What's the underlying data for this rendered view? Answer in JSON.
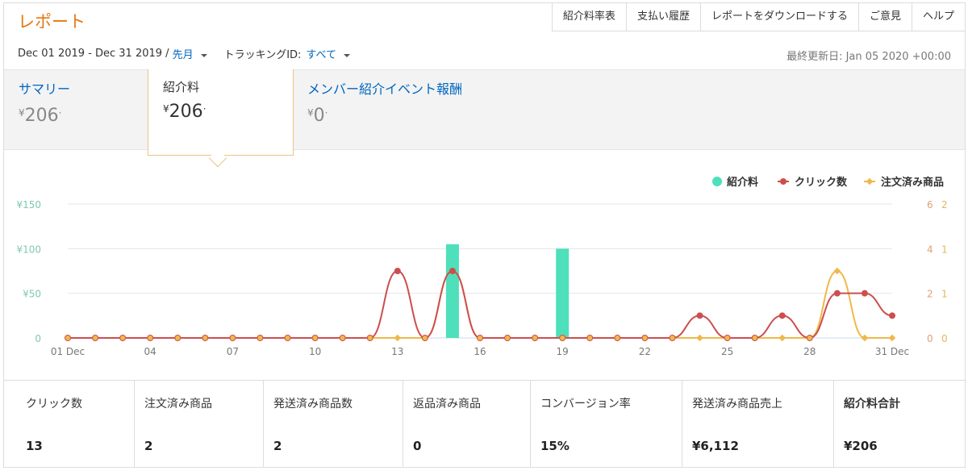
{
  "header": {
    "title": "レポート",
    "nav": [
      "紹介料率表",
      "支払い履歴",
      "レポートをダウンロードする",
      "ご意見",
      "ヘルプ"
    ]
  },
  "filters": {
    "date_range": "Dec 01 2019 - Dec 31 2019 /",
    "period": "先月",
    "tracking_label": "トラッキングID:",
    "tracking_value": "すべて"
  },
  "updated": "最終更新日: Jan 05 2020 +00:00",
  "summary": {
    "summary_label": "サマリー",
    "summary_value": "206",
    "referral_label": "紹介料",
    "referral_value": "206",
    "member_label": "メンバー紹介イベント報酬",
    "member_value": "0",
    "currency": "¥",
    "dot": "·"
  },
  "legend": [
    "紹介料",
    "クリック数",
    "注文済み商品"
  ],
  "colors": {
    "fee": "#4de0bb",
    "clicks": "#cc4e4e",
    "orders": "#f0b84a",
    "accent": "#e47911",
    "link": "#0066c0"
  },
  "chart_data": {
    "type": "line",
    "x": [
      1,
      2,
      3,
      4,
      5,
      6,
      7,
      8,
      9,
      10,
      11,
      12,
      13,
      14,
      15,
      16,
      17,
      18,
      19,
      20,
      21,
      22,
      23,
      24,
      25,
      26,
      27,
      28,
      29,
      30,
      31
    ],
    "xticks": [
      {
        "day": 1,
        "label": "01 Dec"
      },
      {
        "day": 4,
        "label": "04"
      },
      {
        "day": 7,
        "label": "07"
      },
      {
        "day": 10,
        "label": "10"
      },
      {
        "day": 13,
        "label": "13"
      },
      {
        "day": 16,
        "label": "16"
      },
      {
        "day": 19,
        "label": "19"
      },
      {
        "day": 22,
        "label": "22"
      },
      {
        "day": 25,
        "label": "25"
      },
      {
        "day": 28,
        "label": "28"
      },
      {
        "day": 31,
        "label": "31 Dec"
      }
    ],
    "y_fee_ticks": [
      "¥150",
      "¥100",
      "¥50",
      "0"
    ],
    "y_fee_lim": [
      0,
      150
    ],
    "y_click_ticks": [
      "6",
      "4",
      "2",
      "0"
    ],
    "y_click_lim": [
      0,
      6
    ],
    "y_order_ticks": [
      "2",
      "1",
      "1",
      "0"
    ],
    "y_order_lim": [
      0,
      2
    ],
    "series": [
      {
        "name": "紹介料",
        "kind": "bar",
        "values": [
          0,
          0,
          0,
          0,
          0,
          0,
          0,
          0,
          0,
          0,
          0,
          0,
          0,
          0,
          105,
          0,
          0,
          0,
          100,
          0,
          0,
          0,
          0,
          0,
          0,
          0,
          0,
          0,
          0,
          0,
          0
        ]
      },
      {
        "name": "クリック数",
        "kind": "line",
        "values": [
          0,
          0,
          0,
          0,
          0,
          0,
          0,
          0,
          0,
          0,
          0,
          0,
          3,
          0,
          3,
          0,
          0,
          0,
          0,
          0,
          0,
          0,
          0,
          1,
          0,
          0,
          1,
          0,
          2,
          2,
          1
        ]
      },
      {
        "name": "注文済み商品",
        "kind": "line",
        "values": [
          0,
          0,
          0,
          0,
          0,
          0,
          0,
          0,
          0,
          0,
          0,
          0,
          0,
          0,
          1,
          0,
          0,
          0,
          0,
          0,
          0,
          0,
          0,
          0,
          0,
          0,
          0,
          0,
          1,
          0,
          0
        ]
      }
    ],
    "grid": true,
    "legend_position": "top-right"
  },
  "metrics": [
    {
      "label": "クリック数",
      "value": "13"
    },
    {
      "label": "注文済み商品",
      "value": "2"
    },
    {
      "label": "発送済み商品数",
      "value": "2"
    },
    {
      "label": "返品済み商品",
      "value": "0"
    },
    {
      "label": "コンバージョン率",
      "value": "15%"
    },
    {
      "label": "発送済み商品売上",
      "value": "¥6,112"
    },
    {
      "label": "紹介料合計",
      "value": "¥206"
    }
  ]
}
